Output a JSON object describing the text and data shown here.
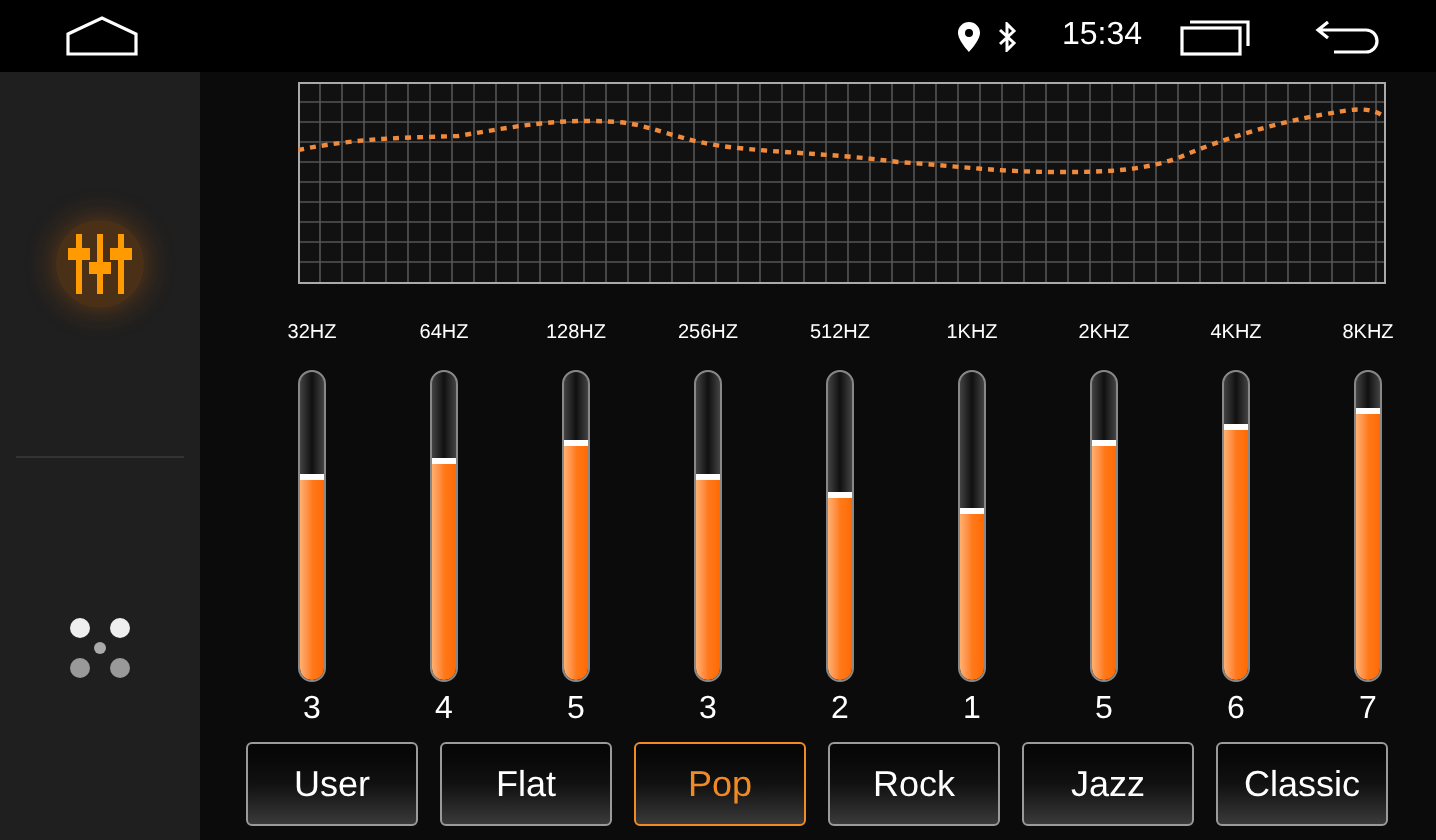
{
  "status_bar": {
    "time": "15:34"
  },
  "sidebar": {
    "items": [
      {
        "kind": "equalizer",
        "selected": true
      },
      {
        "kind": "balance",
        "selected": false
      }
    ]
  },
  "bands": [
    {
      "label": "32HZ",
      "level": 0.67,
      "value": "3"
    },
    {
      "label": "64HZ",
      "level": 0.72,
      "value": "4"
    },
    {
      "label": "128HZ",
      "level": 0.78,
      "value": "5"
    },
    {
      "label": "256HZ",
      "level": 0.67,
      "value": "3"
    },
    {
      "label": "512HZ",
      "level": 0.61,
      "value": "2"
    },
    {
      "label": "1KHZ",
      "level": 0.56,
      "value": "1"
    },
    {
      "label": "2KHZ",
      "level": 0.78,
      "value": "5"
    },
    {
      "label": "4KHZ",
      "level": 0.83,
      "value": "6"
    },
    {
      "label": "8KHZ",
      "level": 0.88,
      "value": "7"
    }
  ],
  "presets": [
    {
      "label": "User",
      "selected": false
    },
    {
      "label": "Flat",
      "selected": false
    },
    {
      "label": "Pop",
      "selected": true
    },
    {
      "label": "Rock",
      "selected": false
    },
    {
      "label": "Jazz",
      "selected": false
    },
    {
      "label": "Classic",
      "selected": false
    }
  ]
}
